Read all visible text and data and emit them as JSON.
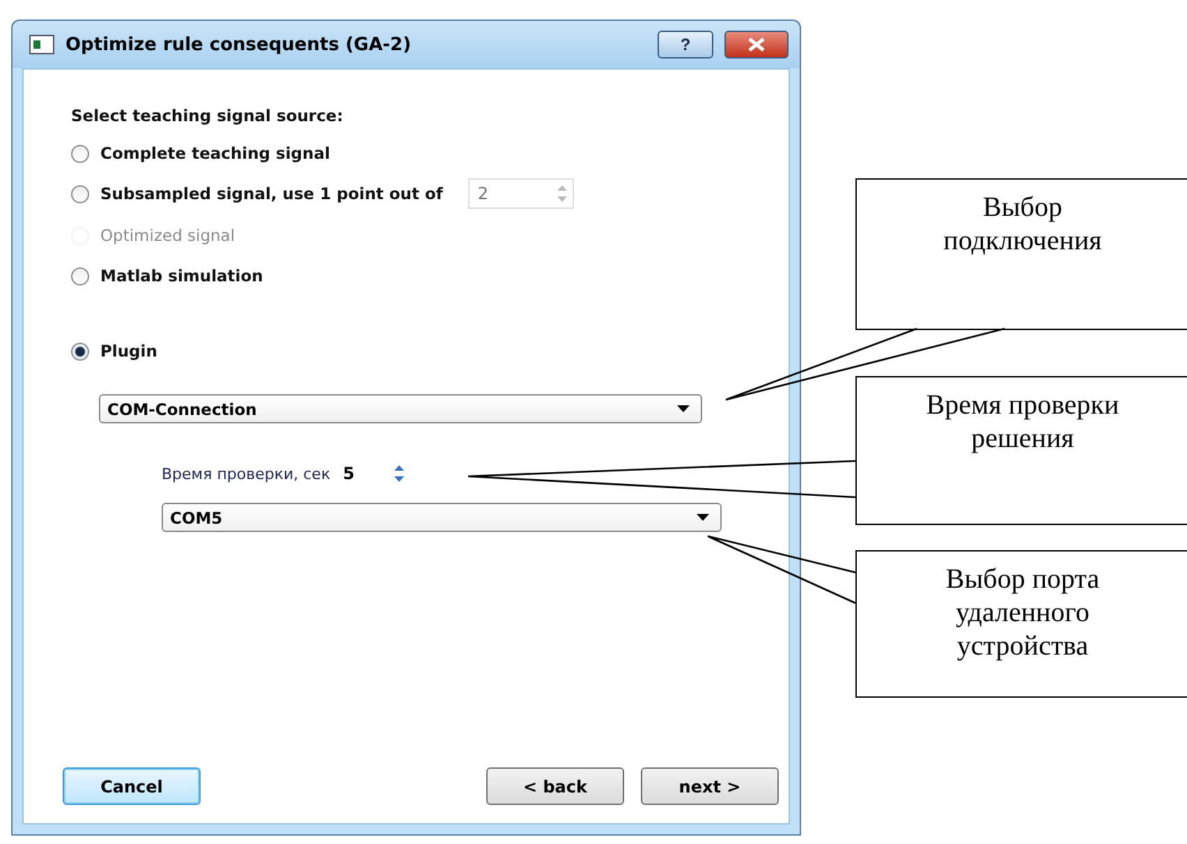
{
  "window": {
    "title": "Optimize rule consequents (GA-2)",
    "help_button": "?"
  },
  "source": {
    "label": "Select teaching signal source:",
    "options": [
      {
        "label": "Complete teaching signal",
        "selected": false,
        "disabled": false,
        "kind": "plain"
      },
      {
        "label": "Subsampled signal, use 1 point out of",
        "selected": false,
        "disabled": false,
        "kind": "spin",
        "spin_value": "2"
      },
      {
        "label": "Optimized signal",
        "selected": false,
        "disabled": true,
        "kind": "plain"
      },
      {
        "label": "Matlab simulation",
        "selected": false,
        "disabled": false,
        "kind": "plain"
      },
      {
        "label": "Plugin",
        "selected": true,
        "disabled": false,
        "kind": "plain"
      }
    ]
  },
  "plugin": {
    "connection": "COM-Connection",
    "check_time_label": "Время проверки, сек",
    "check_time_value": "5",
    "port": "COM5"
  },
  "buttons": {
    "cancel": "Cancel",
    "back": "< back",
    "next": "next >"
  },
  "callouts": [
    {
      "text": "Выбор подключения"
    },
    {
      "text": "Время проверки решения"
    },
    {
      "text": "Выбор порта удаленного устройства"
    }
  ]
}
